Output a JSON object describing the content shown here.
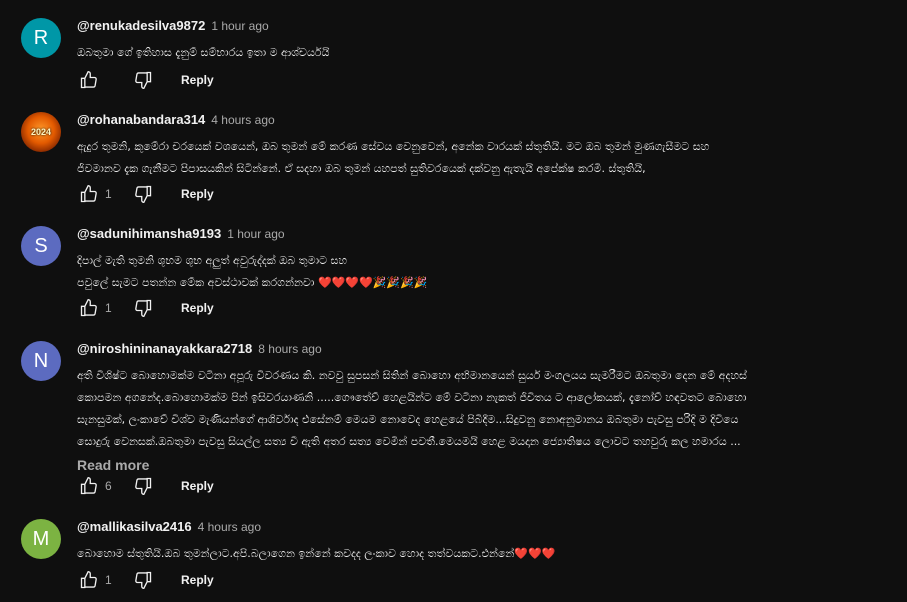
{
  "comments": [
    {
      "avatar_letter": "R",
      "avatar_color": "#0097a7",
      "author": "@renukadesilva9872",
      "time": "1 hour ago",
      "text": "ඔබතුමා ගේ ඉතිහාස දැනුම් සම්භාරය ඉතා ම ආශ්චර්යයි",
      "likes": "",
      "reply_label": "Reply"
    },
    {
      "avatar_letter": "",
      "avatar_text": "2024",
      "author": "@rohanabandara314",
      "time": "4 hours ago",
      "text": "ඇදුර තුමනි, කුමේරා චරයෙක් වශයෙන්, ඔබ තුමන් මේ කරණ සේවය වෙනුවෙන්, අනේක වාරයක් ස්තුතියි. මට ඔබ තුමන් මුණගැසීමට  සහ\nජිවමානව දැක ගැනීමට පිපාසයකින් සිටින්නේ. ඒ සදහා ඔබ තුමන් යහපත් සුතිවරයෙක් දක්වනු ඇතැයි අපේක්ෂ කරමි. ස්තුතියි,",
      "likes": "1",
      "reply_label": "Reply"
    },
    {
      "avatar_letter": "S",
      "avatar_color": "#5c6bc0",
      "author": "@sadunihimansha9193",
      "time": "1 hour ago",
      "text": "දිපාල් මැති තුමනි ශුභම ශුභ  අලුත් අවුරුද්දක්  ඔබ  තුමාට සහ\nපවුලේ සැමට පතන්න  මේක අවස්ථාවක්  කරගන්නවා ",
      "emoji": "❤️❤️❤️❤️🎉🎉🎉🎉",
      "likes": "1",
      "reply_label": "Reply"
    },
    {
      "avatar_letter": "N",
      "avatar_color": "#5c6bc0",
      "author": "@niroshininanayakkara2718",
      "time": "8 hours ago",
      "text": "අති විශිෂ්ට බොහොමක්ම වටිනා අපූරු විවරණය කි. නවවු සුපසන් සිතින් බොහො  අභිමානයෙන් සුයර් මංගලයය සැමරීමට ඔබතුමා දෙන මේ අදහස්\nකොපමන අගනේද.බොහොමක්ම පින් ඉසිවරයාණනි .....ගෞතේව් හෙළයින්ට මේ වටිනා නැකත් ජිවිතය ට ආලෝකයක්, දැනෝව් හඳවතට බොහො\nසැනසුමක්, ලංකාවේ විශ්ව මැණියන්ගේ ආශිර්වාද  එසේනම් මෙයම නොවෙද හෙළයේ පිබිදීම...සිදුවනු නොඅනුමානය ඔබතුමා පැවසු පරිදි ම දිවියෙ\nසොදුරු වෙනසක්.ඔබතුමා පැවසු සියල්ල සත්‍ය වී ඇති අතර සත්‍ය වෙමින් පවතී.මෙයමයි හෙළ මයදාන ජ්‍යොතිෂය ලොවට තහවුරු කල හමාරය ...",
      "read_more": "Read more",
      "likes": "6",
      "reply_label": "Reply"
    },
    {
      "avatar_letter": "M",
      "avatar_color": "#7cb342",
      "author": "@mallikasilva2416",
      "time": "4 hours ago",
      "text": "බොහොම ස්තුතියි.ඔබ තුමන්ලාට.අපි.බලාගෙන ඉන්නේ කවදද ලංකාව හොද තත්වයකට.එන්නේ",
      "emoji": "❤️❤️❤️",
      "likes": "1",
      "reply_label": "Reply"
    }
  ]
}
